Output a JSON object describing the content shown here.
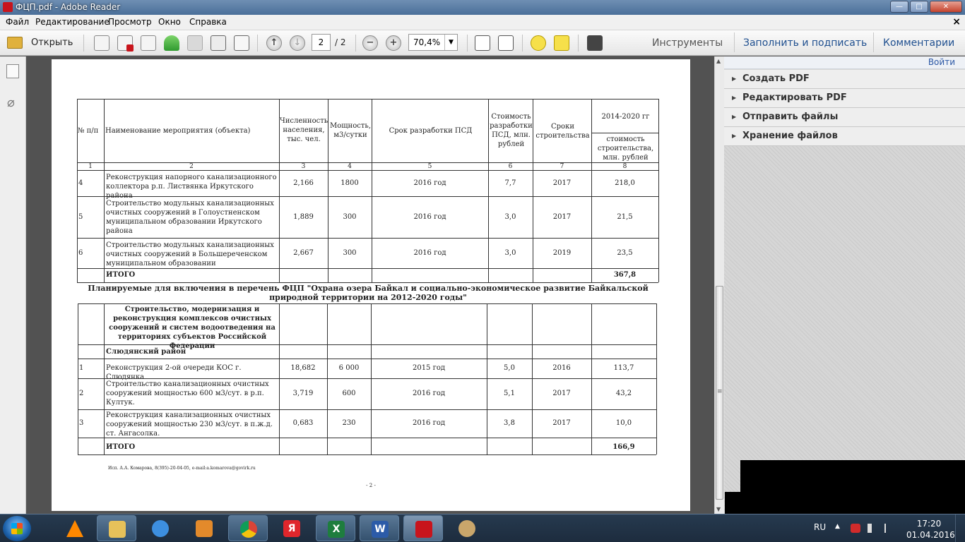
{
  "window": {
    "title": "ФЦП.pdf - Adobe Reader",
    "min": "—",
    "max": "□",
    "close": "✕",
    "app_icon": "pdf-icon"
  },
  "menu": {
    "items": [
      "Файл",
      "Редактирование",
      "Просмотр",
      "Окно",
      "Справка"
    ],
    "close": "×"
  },
  "toolbar": {
    "open_label": "Открыть",
    "page_current": "2",
    "page_total": "/ 2",
    "zoom": "70,4%",
    "links": [
      "Инструменты",
      "Заполнить и подписать",
      "Комментарии"
    ]
  },
  "right_pane": {
    "signin": "Войти",
    "items": [
      "Создать PDF",
      "Редактировать PDF",
      "Отправить файлы",
      "Хранение файлов"
    ]
  },
  "document": {
    "header": {
      "col1": "№ п/п",
      "col2": "Наименование мероприятия (объекта)",
      "col3": "Численность населения, тыс. чел.",
      "col4": "Мощность, м3/сутки",
      "col5": "Срок разработки ПСД",
      "col6": "Стоимость разработки ПСД, млн. рублей",
      "col7": "Сроки строительства",
      "col8_top": "2014-2020 гг",
      "col8_bottom": "стоимость строительства, млн. рублей"
    },
    "col_numbers": [
      "1",
      "2",
      "3",
      "4",
      "5",
      "6",
      "7",
      "8"
    ],
    "rows_top": [
      {
        "n": "4",
        "name": "Реконструкция напорного канализационного коллектора р.п. Листвянка Иркутского района",
        "pop": "2,166",
        "cap": "1800",
        "psd": "2016 год",
        "psd_cost": "7,7",
        "build": "2017",
        "cost": "218,0"
      },
      {
        "n": "5",
        "name": "Строительство модульных канализационных очистных сооружений в Голоустненском муниципальном образовании Иркутского района",
        "pop": "1,889",
        "cap": "300",
        "psd": "2016 год",
        "psd_cost": "3,0",
        "build": "2017",
        "cost": "21,5"
      },
      {
        "n": "6",
        "name": "Строительство модульных канализационных очистных сооружений в Большереченском муниципальном образовании",
        "pop": "2,667",
        "cap": "300",
        "psd": "2016 год",
        "psd_cost": "3,0",
        "build": "2019",
        "cost": "23,5"
      }
    ],
    "total_top": {
      "label": "ИТОГО",
      "value": "367,8"
    },
    "section_heading": "Планируемые для включения в перечень ФЦП \"Охрана озера Байкал и социально-экономическое развитие Байкальской природной территории на 2012-2020 годы\"",
    "sub_heading": "Строительство, модернизация и реконструкция комплексов очистных сооружений и систем водоотведения на территориях субъектов Российской Федерации",
    "district": "Слюдянский район",
    "rows_bottom": [
      {
        "n": "1",
        "name": "Реконструкция 2-ой очереди КОС г. Слюдянка",
        "pop": "18,682",
        "cap": "6 000",
        "psd": "2015 год",
        "psd_cost": "5,0",
        "build": "2016",
        "cost": "113,7"
      },
      {
        "n": "2",
        "name": "Строительство канализационных очистных сооружений мощностью 600 м3/сут. в р.п. Култук.",
        "pop": "3,719",
        "cap": "600",
        "psd": "2016 год",
        "psd_cost": "5,1",
        "build": "2017",
        "cost": "43,2"
      },
      {
        "n": "3",
        "name": "Реконструкция канализационных очистных сооружений мощностью 230 м3/сут. в п.ж.д. ст. Ангасолка.",
        "pop": "0,683",
        "cap": "230",
        "psd": "2016 год",
        "psd_cost": "3,8",
        "build": "2017",
        "cost": "10,0"
      }
    ],
    "total_bottom": {
      "label": "ИТОГО",
      "value": "166,9"
    },
    "footnote": "Исп. А.А. Комарова, 8(395)-20-04-05, e-mail:a.komarova@govirk.ru",
    "page_num": "- 2 -"
  },
  "taskbar": {
    "lang": "RU",
    "time": "17:20",
    "date": "01.04.2016",
    "apps": [
      "vlc-icon",
      "file-explorer-icon",
      "speaker-app-icon",
      "media-player-icon",
      "chrome-icon",
      "yandex-icon",
      "excel-icon",
      "word-icon",
      "acrobat-icon",
      "paint-icon"
    ],
    "glyphs": {
      "yandex": "Я",
      "excel": "X",
      "word": "W"
    }
  }
}
